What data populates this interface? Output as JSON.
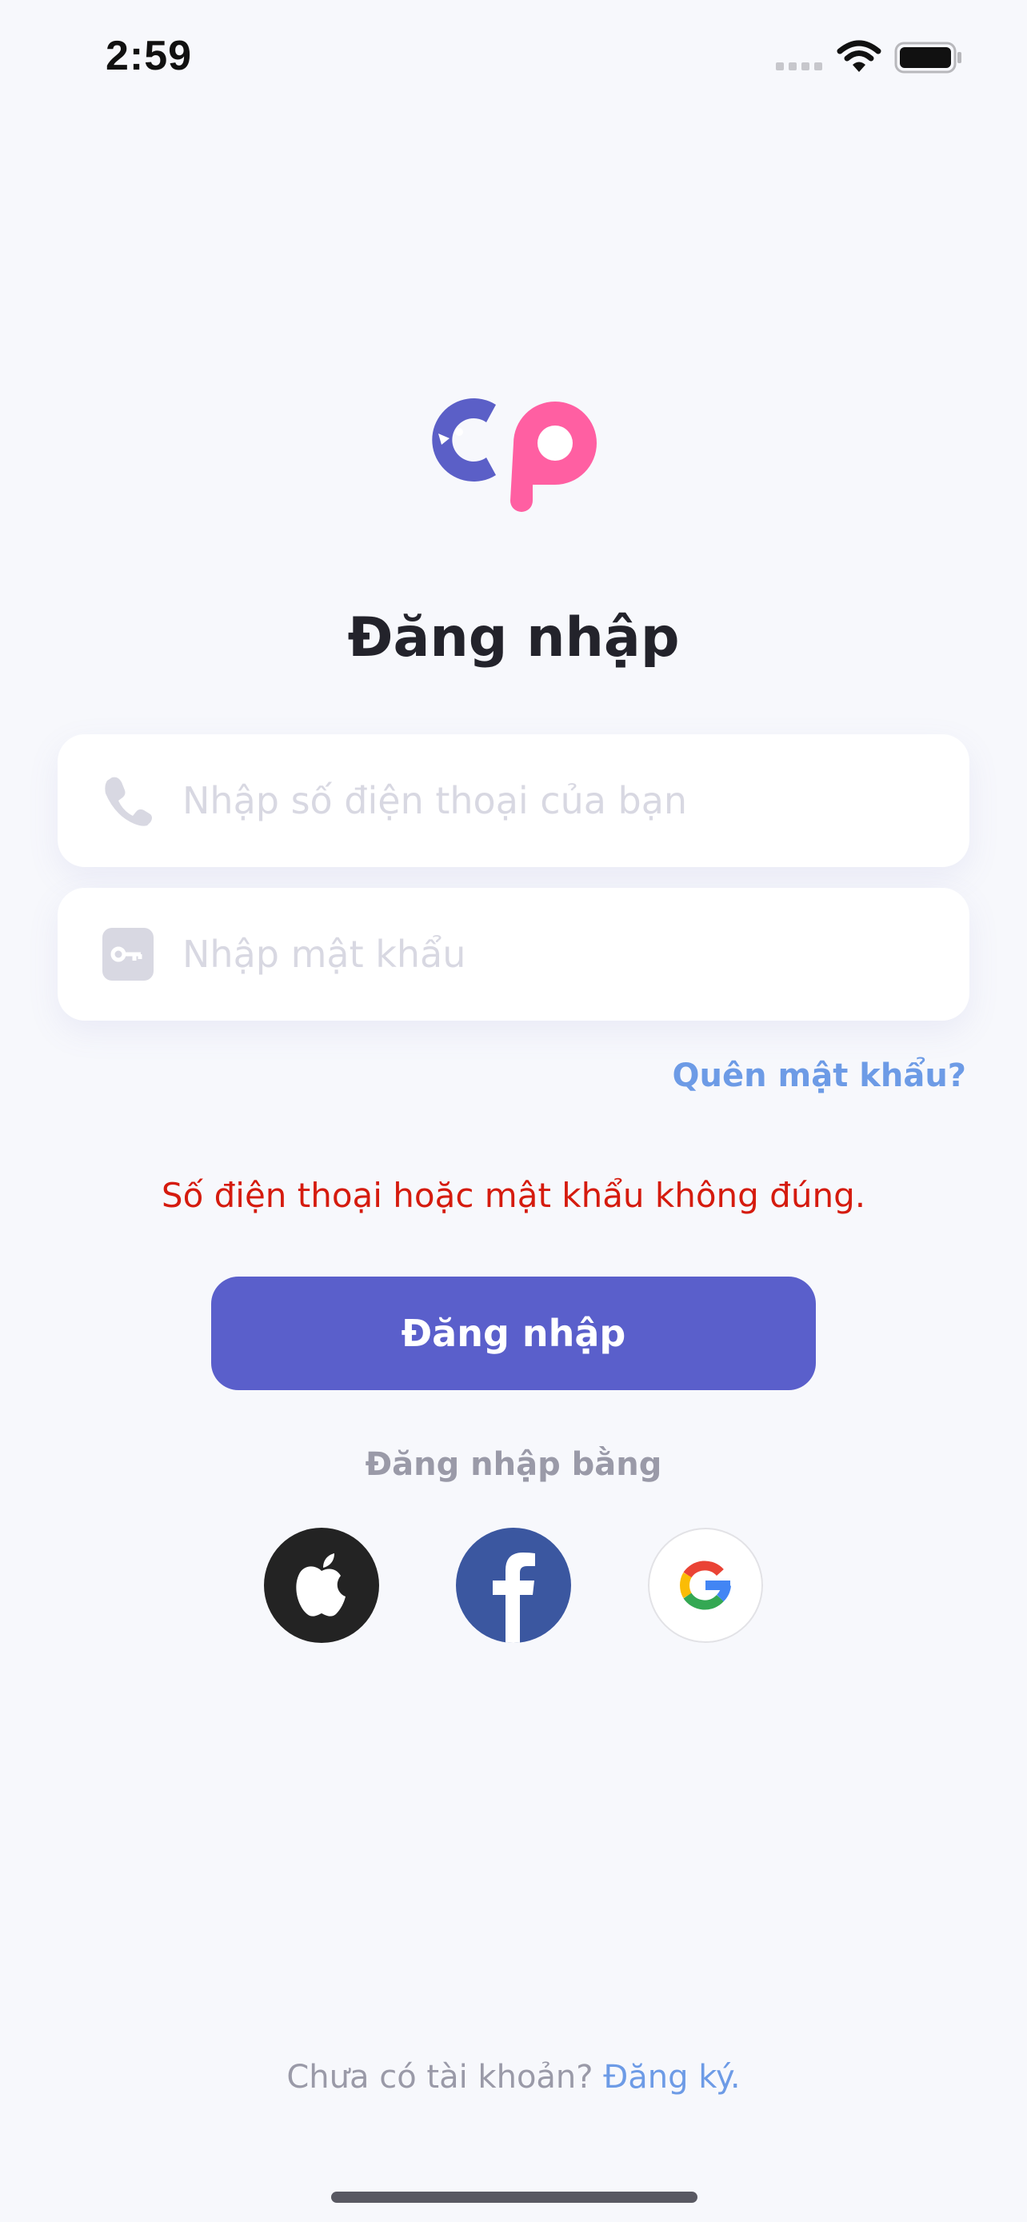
{
  "status_bar": {
    "time": "2:59"
  },
  "login": {
    "title": "Đăng nhập",
    "phone_placeholder": "Nhập số điện thoại của bạn",
    "password_placeholder": "Nhập mật khẩu",
    "forgot_password": "Quên mật khẩu?",
    "error_message": "Số điện thoại hoặc mật khẩu không đúng.",
    "submit_label": "Đăng nhập",
    "social_label": "Đăng nhập bằng",
    "social_providers": [
      "apple-icon",
      "facebook-icon",
      "google-icon"
    ]
  },
  "footer": {
    "signup_prompt": "Chưa có tài khoản?",
    "signup_link": "Đăng ký."
  },
  "colors": {
    "background": "#f7f8fc",
    "primary": "#5a5fcb",
    "link": "#6d9be6",
    "error": "#d51b0e",
    "logo_purple": "#5b5fc7",
    "logo_pink": "#ff5fa2"
  }
}
